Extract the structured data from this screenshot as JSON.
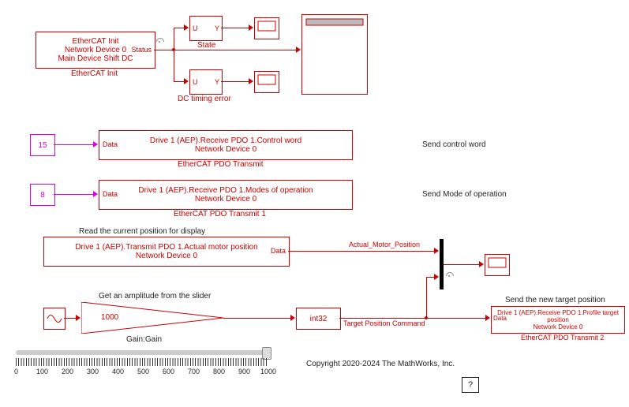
{
  "ethercat_init": {
    "line1": "EtherCAT Init",
    "line2": "Network Device 0",
    "line3": "Main Device Shift DC",
    "port_out": "Status",
    "name_below": "EtherCAT Init"
  },
  "state_sel": {
    "in": "U",
    "out": "Y",
    "label": "State"
  },
  "dc_sel": {
    "in": "U",
    "out": "Y",
    "label": "DC timing error"
  },
  "const15": {
    "value": "15"
  },
  "const8": {
    "value": "8"
  },
  "pdo_tx0": {
    "port_in": "Data",
    "line1": "Drive 1 (AEP).Receive PDO 1.Control word",
    "line2": "Network Device 0",
    "name_below": "EtherCAT PDO Transmit",
    "annot": "Send control word"
  },
  "pdo_tx1": {
    "port_in": "Data",
    "line1": "Drive 1 (AEP).Receive PDO 1.Modes of operation",
    "line2": "Network Device 0",
    "name_below": "EtherCAT PDO Transmit 1",
    "annot": "Send Mode of operation"
  },
  "pdo_rx": {
    "annot_above": "Read the current position for display",
    "line1": "Drive 1 (AEP).Transmit PDO 1.Actual motor position",
    "line2": "Network Device 0",
    "port_out": "Data"
  },
  "sig1_label": "Actual_Motor_Position",
  "sig2_label": "Target Position Command",
  "gain": {
    "value": "1000",
    "annot_above": "Get an amplitude from the slider",
    "name_below": "Gain:Gain"
  },
  "dtc": {
    "text": "int32"
  },
  "pdo_tx2": {
    "port_in": "Data",
    "line1": "Drive 1 (AEP).Receive PDO 1.Profile target position",
    "line2": "Network Device 0",
    "name_below": "EtherCAT PDO Transmit 2",
    "annot": "Send the new target position"
  },
  "slider": {
    "ticks": [
      "0",
      "100",
      "200",
      "300",
      "400",
      "500",
      "600",
      "700",
      "800",
      "900",
      "1000"
    ]
  },
  "footer": "Copyright 2020-2024 The MathWorks, Inc.",
  "help": "?"
}
